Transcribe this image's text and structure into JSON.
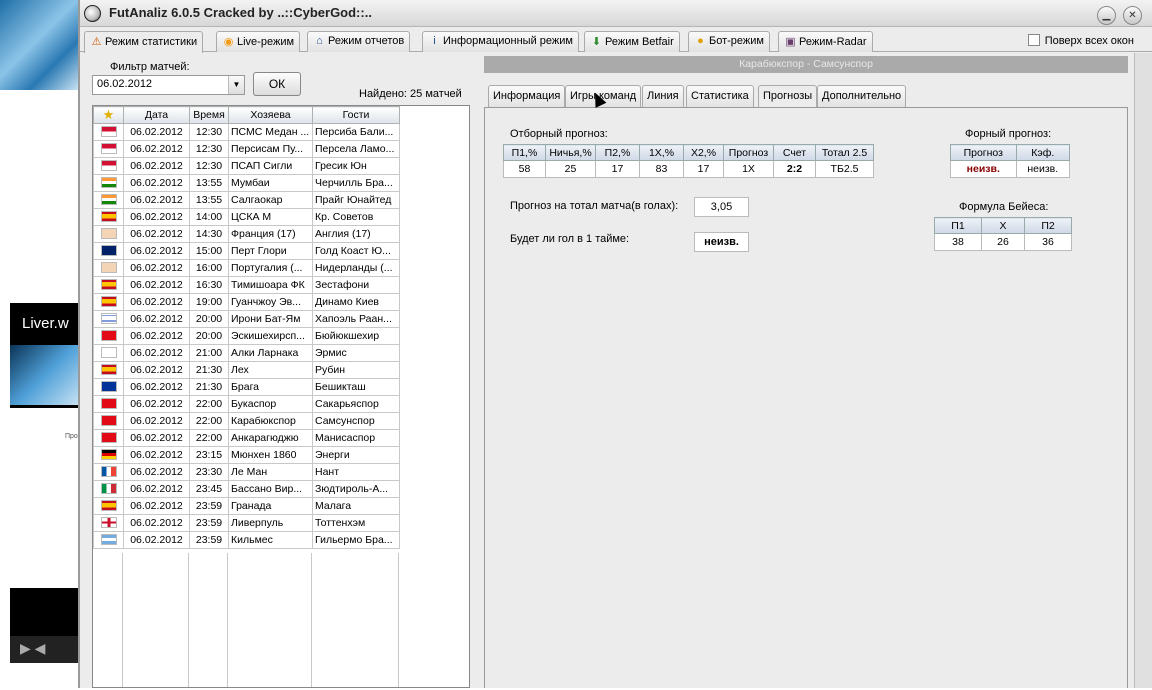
{
  "window": {
    "title": "FutAnaliz 6.0.5 Cracked by ..::CyberGod::..",
    "minimize_icon": "minimize-icon",
    "close_icon": "close-icon"
  },
  "background": {
    "video_title": "Liver.w",
    "page_text": "Про"
  },
  "main_tabs": [
    {
      "label": "Режим статистики",
      "icon": "warning-icon",
      "glyph": "⚠",
      "color": "#d35400"
    },
    {
      "label": "Live-режим",
      "icon": "rss-icon",
      "glyph": "◉",
      "color": "#f39c12"
    },
    {
      "label": "Режим отчетов",
      "icon": "house-icon",
      "glyph": "⌂",
      "color": "#1f4e8c"
    },
    {
      "label": "Информационный режим",
      "icon": "info-icon",
      "glyph": "i",
      "color": "#1f4e8c"
    },
    {
      "label": "Режим Betfair",
      "icon": "arrow-down-icon",
      "glyph": "⬇",
      "color": "#2f8a2f"
    },
    {
      "label": "Бот-режим",
      "icon": "chat-icon",
      "glyph": "●",
      "color": "#e0a100"
    },
    {
      "label": "Режим-Radar",
      "icon": "radar-icon",
      "glyph": "▣",
      "color": "#6b3d6b"
    }
  ],
  "always_on_top": "Поверх всех окон",
  "filter": {
    "label": "Фильтр матчей:",
    "value": "06.02.2012",
    "ok_label": "ОК",
    "found": "Найдено: 25 матчей"
  },
  "grid": {
    "headers": [
      "",
      "Дата",
      "Время",
      "Хозяева",
      "Гости"
    ],
    "rows": [
      {
        "flag": "indonesia",
        "date": "06.02.2012",
        "time": "12:30",
        "home": "ПСМС Медан ...",
        "away": "Персиба Бали..."
      },
      {
        "flag": "indonesia",
        "date": "06.02.2012",
        "time": "12:30",
        "home": "Персисам Пу...",
        "away": "Персела Ламо..."
      },
      {
        "flag": "indonesia",
        "date": "06.02.2012",
        "time": "12:30",
        "home": "ПСАП Сигли",
        "away": "Гресик Юн"
      },
      {
        "flag": "india",
        "date": "06.02.2012",
        "time": "13:55",
        "home": "Мумбаи",
        "away": "Черчилль Бра..."
      },
      {
        "flag": "india",
        "date": "06.02.2012",
        "time": "13:55",
        "home": "Салгаокар",
        "away": "Прайг Юнайтед"
      },
      {
        "flag": "spain",
        "date": "06.02.2012",
        "time": "14:00",
        "home": "ЦСКА М",
        "away": "Кр. Советов"
      },
      {
        "flag": "hand",
        "date": "06.02.2012",
        "time": "14:30",
        "home": "Франция (17)",
        "away": "Англия (17)"
      },
      {
        "flag": "australia",
        "date": "06.02.2012",
        "time": "15:00",
        "home": "Перт Глори",
        "away": "Голд Коаст Ю..."
      },
      {
        "flag": "hand",
        "date": "06.02.2012",
        "time": "16:00",
        "home": "Португалия (...",
        "away": "Нидерланды (..."
      },
      {
        "flag": "spain",
        "date": "06.02.2012",
        "time": "16:30",
        "home": "Тимишоара ФК",
        "away": "Зестафони"
      },
      {
        "flag": "spain",
        "date": "06.02.2012",
        "time": "19:00",
        "home": "Гуанчжоу Эв...",
        "away": "Динамо Киев"
      },
      {
        "flag": "israel",
        "date": "06.02.2012",
        "time": "20:00",
        "home": "Ирони Бат-Ям",
        "away": "Хапоэль Раан..."
      },
      {
        "flag": "turkey",
        "date": "06.02.2012",
        "time": "20:00",
        "home": "Эскишехирсп...",
        "away": "Бюйюкшехир"
      },
      {
        "flag": "cyprus",
        "date": "06.02.2012",
        "time": "21:00",
        "home": "Алки Ларнака",
        "away": "Эрмис"
      },
      {
        "flag": "spain",
        "date": "06.02.2012",
        "time": "21:30",
        "home": "Лех",
        "away": "Рубин"
      },
      {
        "flag": "eu",
        "date": "06.02.2012",
        "time": "21:30",
        "home": "Брага",
        "away": "Бешикташ"
      },
      {
        "flag": "turkey",
        "date": "06.02.2012",
        "time": "22:00",
        "home": "Букаспор",
        "away": "Сакарьяспор"
      },
      {
        "flag": "turkey",
        "date": "06.02.2012",
        "time": "22:00",
        "home": "Карабюкспор",
        "away": "Самсунспор"
      },
      {
        "flag": "turkey",
        "date": "06.02.2012",
        "time": "22:00",
        "home": "Анкарагюджю",
        "away": "Манисаспор"
      },
      {
        "flag": "germany",
        "date": "06.02.2012",
        "time": "23:15",
        "home": "Мюнхен 1860",
        "away": "Энерги"
      },
      {
        "flag": "france",
        "date": "06.02.2012",
        "time": "23:30",
        "home": "Ле Ман",
        "away": "Нант"
      },
      {
        "flag": "italy",
        "date": "06.02.2012",
        "time": "23:45",
        "home": "Бассано Вир...",
        "away": "Зюдтироль-А..."
      },
      {
        "flag": "spain",
        "date": "06.02.2012",
        "time": "23:59",
        "home": "Гранада",
        "away": "Малага"
      },
      {
        "flag": "england",
        "date": "06.02.2012",
        "time": "23:59",
        "home": "Ливерпуль",
        "away": "Тоттенхэм"
      },
      {
        "flag": "argentina",
        "date": "06.02.2012",
        "time": "23:59",
        "home": "Кильмес",
        "away": "Гильермо Бра..."
      }
    ]
  },
  "match_title": "Карабюкспор - Самсунспор",
  "sub_tabs": [
    "Информация",
    "Игры команд",
    "Линия",
    "Статистика",
    "Прогнозы",
    "Дополнительно"
  ],
  "forecast": {
    "label": "Отборный прогноз:",
    "headers": [
      "П1,%",
      "Ничья,%",
      "П2,%",
      "1Х,%",
      "Х2,%",
      "Прогноз",
      "Счет",
      "Тотал 2.5"
    ],
    "values": [
      "58",
      "25",
      "17",
      "83",
      "17",
      "1Х",
      "2:2",
      "ТБ2.5"
    ]
  },
  "total_forecast": {
    "label": "Прогноз на тотал матча(в голах):",
    "value": "3,05"
  },
  "first_half_goal": {
    "label": "Будет ли гол в 1 тайме:",
    "value": "неизв."
  },
  "form_forecast": {
    "label": "Форный прогноз:",
    "headers": [
      "Прогноз",
      "Кэф."
    ],
    "values": [
      "неизв.",
      "неизв."
    ]
  },
  "bayes": {
    "label": "Формула Бейеса:",
    "headers": [
      "П1",
      "Х",
      "П2"
    ],
    "values": [
      "38",
      "26",
      "36"
    ]
  }
}
